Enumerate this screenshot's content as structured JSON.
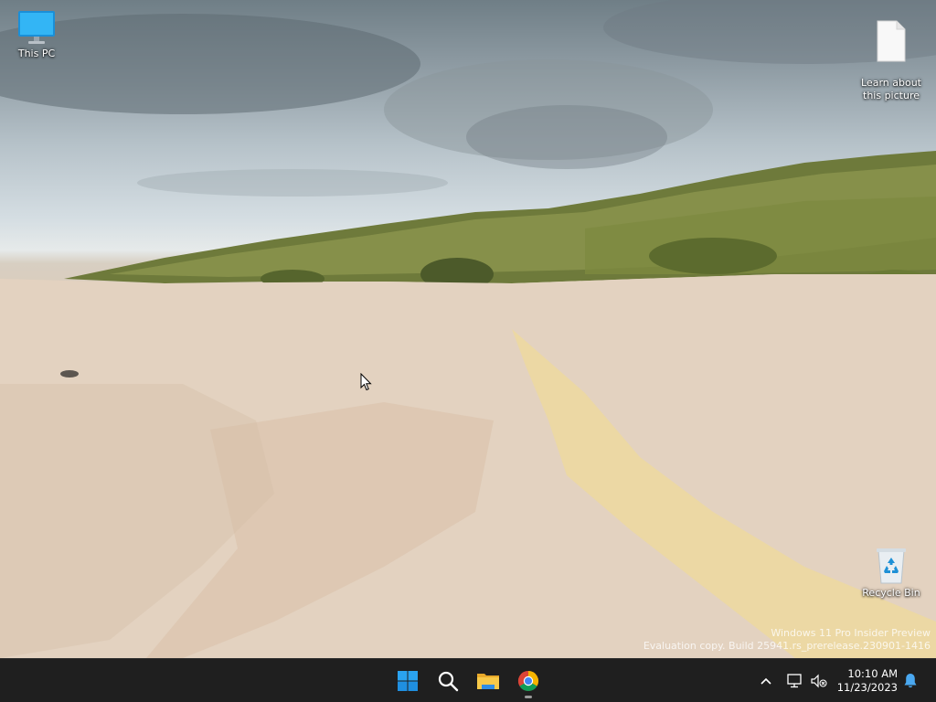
{
  "desktop": {
    "icons": [
      {
        "label": "This PC",
        "icon": "monitor-icon"
      },
      {
        "label": "Learn about\nthis picture",
        "icon": "document-icon"
      },
      {
        "label": "Recycle Bin",
        "icon": "recycle-bin-icon"
      }
    ],
    "watermark": {
      "line1": "Windows 11 Pro Insider Preview",
      "line2": "Evaluation copy. Build 25941.rs_prerelease.230901-1416"
    }
  },
  "taskbar": {
    "apps": [
      {
        "icon": "windows-start-icon"
      },
      {
        "icon": "search-icon"
      },
      {
        "icon": "file-explorer-icon"
      },
      {
        "icon": "chrome-icon",
        "running": true
      }
    ],
    "tray": {
      "chevron": "chevron-up-icon",
      "network": "network-icon",
      "volume": "volume-muted-icon",
      "notifications": "notification-bell-icon"
    },
    "clock": {
      "time": "10:10 AM",
      "date": "11/23/2023"
    }
  },
  "colors": {
    "taskbar_bg": "#1f1f1f",
    "accent_blue": "#2aa3f0",
    "folder_yellow": "#f7c948"
  }
}
